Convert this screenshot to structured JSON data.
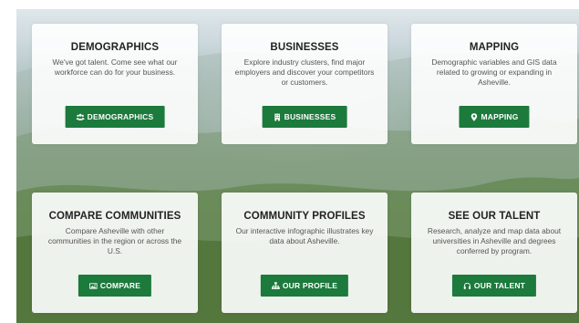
{
  "cards": [
    {
      "title": "DEMOGRAPHICS",
      "description": "We've got talent. Come see what our workforce can do for your business.",
      "button_label": "DEMOGRAPHICS",
      "icon": "people-icon"
    },
    {
      "title": "BUSINESSES",
      "description": "Explore industry clusters, find major employers and discover your competitors or customers.",
      "button_label": "BUSINESSES",
      "icon": "building-icon"
    },
    {
      "title": "MAPPING",
      "description": "Demographic variables and GIS data related to growing or expanding in Asheville.",
      "button_label": "MAPPING",
      "icon": "map-marker-icon"
    },
    {
      "title": "COMPARE COMMUNITIES",
      "description": "Compare Asheville with other communities in the region or across the U.S.",
      "button_label": "COMPARE",
      "icon": "picture-icon"
    },
    {
      "title": "COMMUNITY PROFILES",
      "description": "Our interactive infographic illustrates key data about Asheville.",
      "button_label": "OUR PROFILE",
      "icon": "sitemap-icon"
    },
    {
      "title": "SEE OUR TALENT",
      "description": "Research, analyze and map data about universities in Asheville and degrees conferred by program.",
      "button_label": "OUR TALENT",
      "icon": "headset-icon"
    }
  ],
  "colors": {
    "button": "#1c7a3c",
    "card_background": "#ffffff"
  }
}
